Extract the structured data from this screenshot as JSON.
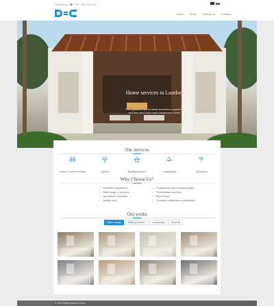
{
  "header": {
    "contact": "Contact us: ☎ +44 7 932 00 00 11",
    "nav": [
      "Home",
      "About",
      "Services ▾",
      "Contacts"
    ],
    "flags": [
      "uk",
      "ru"
    ],
    "logo_icon": "dc-logo"
  },
  "hero": {
    "title": "Home services in London",
    "subtitle": "From appliance care to interior and exterior upgrades, we'll take care of your home maintenance needs"
  },
  "services": {
    "title": "Our services",
    "items": [
      {
        "label": "Interior & exterior design",
        "icon": "chair-icon"
      },
      {
        "label": "Lighting",
        "icon": "lamp-icon"
      },
      {
        "label": "Building services",
        "icon": "house-icon"
      },
      {
        "label": "Landscaping",
        "icon": "tree-icon"
      },
      {
        "label": "Handyman",
        "icon": "hammer-icon"
      }
    ]
  },
  "why": {
    "title": "Why Choose Us?",
    "items": [
      "Extensive experience",
      "Professional and dedicated team",
      "Wide range of services",
      "Personalised services",
      "Specialized expertise",
      "Best Prices",
      "Quality work",
      "Customer satisfaction guaranteed"
    ]
  },
  "works": {
    "title": "Our works",
    "filters": [
      "Interior design",
      "Building services",
      "Landscaping",
      "Show all"
    ],
    "active_filter": "Interior design",
    "gallery": [
      {
        "color": "#8c7a63"
      },
      {
        "color": "#a89a86"
      },
      {
        "color": "#c4c0b8"
      },
      {
        "color": "#9e8f7a"
      },
      {
        "color": "#7d7f86"
      },
      {
        "color": "#b59d83"
      },
      {
        "color": "#8f8576"
      },
      {
        "color": "#6f7073"
      }
    ]
  },
  "footer": {
    "copyright": "© 2018 Dubai Business Group"
  },
  "colors": {
    "accent": "#1e8fd5",
    "footer": "#636363"
  }
}
